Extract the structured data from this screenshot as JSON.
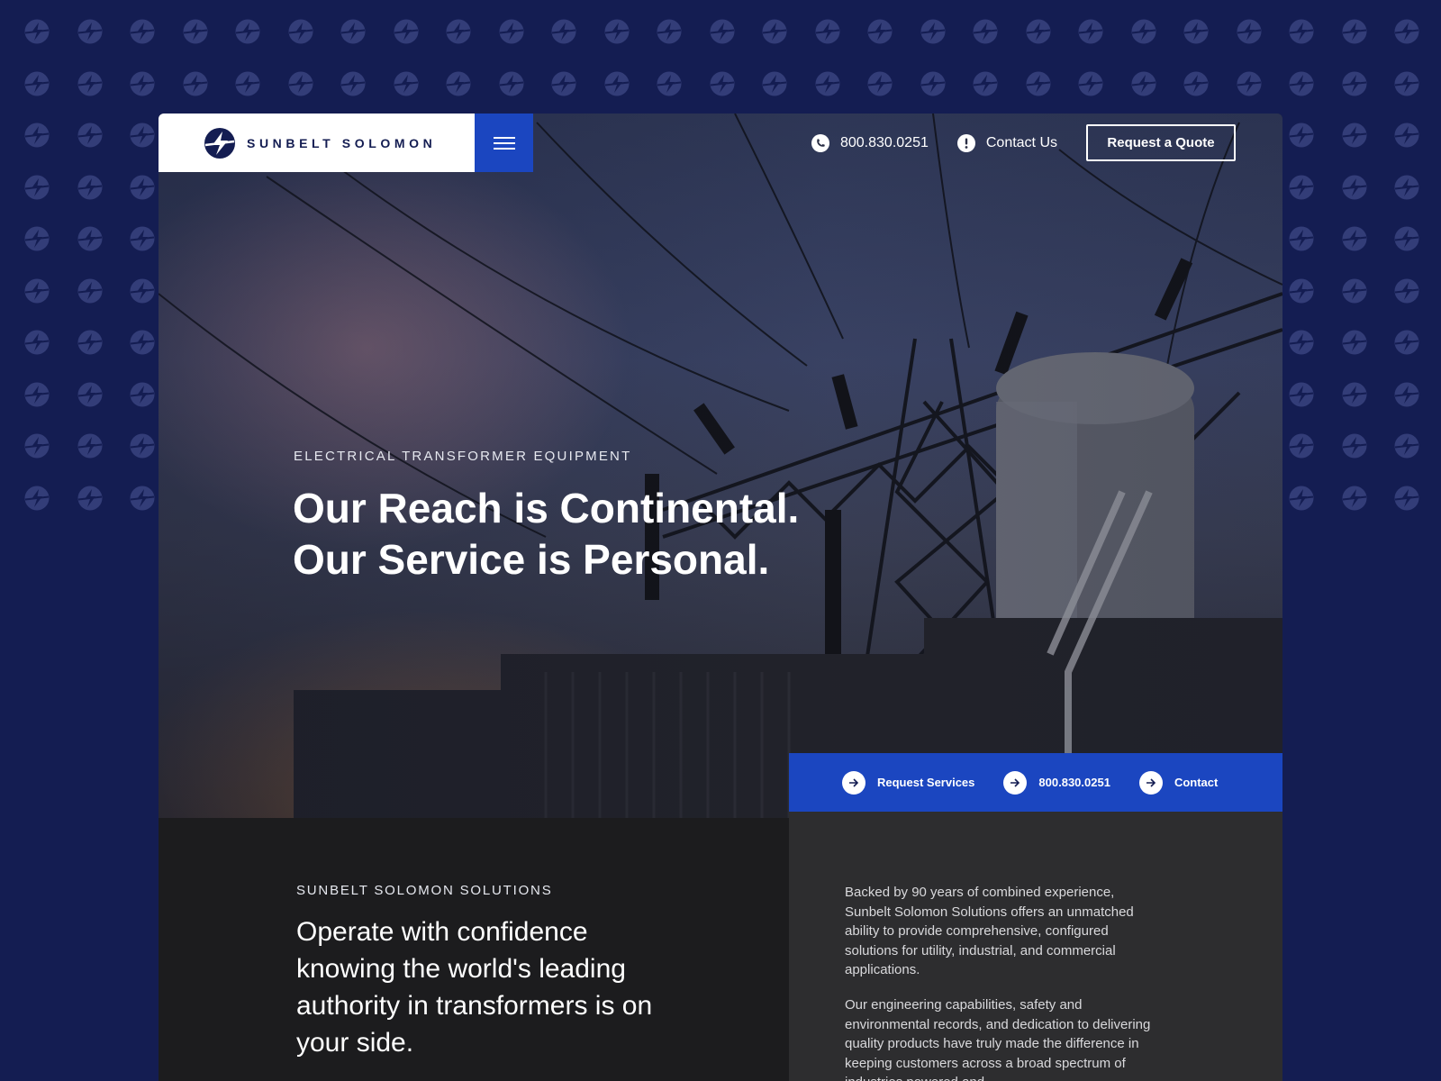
{
  "colors": {
    "page_background": "#141d52",
    "brand_blue": "#1b46c0",
    "navy": "#141d52",
    "dark_panel": "#1c1c1e",
    "gray_panel": "#2d2d2f"
  },
  "brand": {
    "name": "SUNBELT SOLOMON",
    "logo_icon": "bolt-circle-icon"
  },
  "nav": {
    "menu_icon": "hamburger-menu-icon",
    "phone_label": "800.830.0251",
    "phone_icon": "phone-icon",
    "contact_label": "Contact Us",
    "contact_icon": "exclamation-circle-icon",
    "quote_label": "Request a Quote"
  },
  "hero": {
    "eyebrow": "ELECTRICAL TRANSFORMER EQUIPMENT",
    "title_line1": "Our Reach is Continental.",
    "title_line2": "Our Service is Personal."
  },
  "quick_links": [
    {
      "label": "Request Services",
      "icon": "arrow-right-icon"
    },
    {
      "label": "800.830.0251",
      "icon": "arrow-right-icon"
    },
    {
      "label": "Contact",
      "icon": "arrow-right-icon"
    }
  ],
  "solutions": {
    "eyebrow": "SUNBELT SOLOMON SOLUTIONS",
    "title": "Operate with confidence knowing the world's leading authority in transformers is on your side.",
    "paragraph1": "Backed by 90 years of combined experience, Sunbelt Solomon Solutions offers an unmatched ability to provide comprehensive, configured solutions for utility, industrial, and commercial applications.",
    "paragraph2": "Our engineering capabilities, safety and environmental records, and dedication to delivering quality products have truly made the difference in keeping customers across a broad spectrum of industries powered and"
  }
}
